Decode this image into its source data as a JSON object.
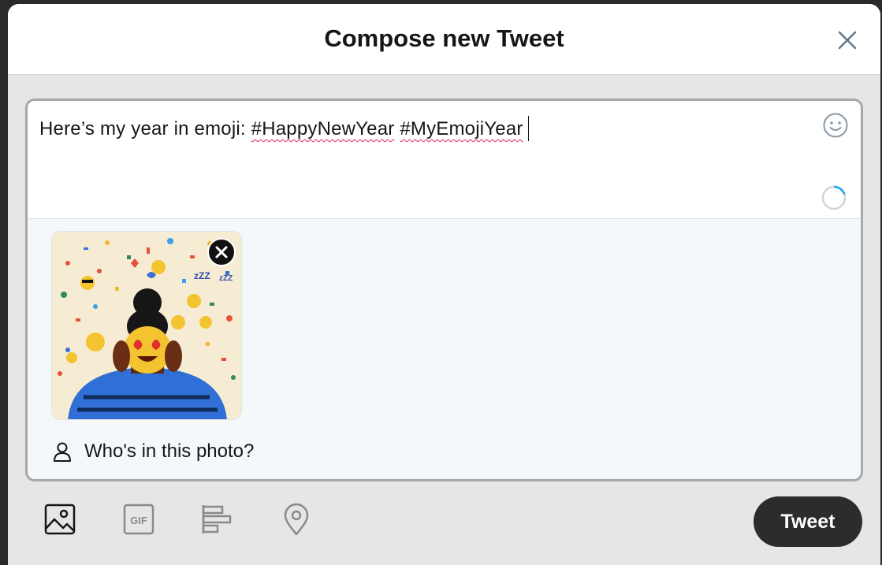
{
  "dialog": {
    "title": "Compose new Tweet",
    "close_icon": "close-icon"
  },
  "composer": {
    "text_prefix": "Here’s my year in emoji: ",
    "hashtags": [
      "#HappyNewYear",
      "#MyEmojiYear"
    ],
    "emoji_icon": "smiley-icon",
    "counter_progress": 0.2
  },
  "media": {
    "remove_icon": "close-icon",
    "tag_people_label": "Who's in this photo?",
    "tag_people_icon": "person-icon"
  },
  "toolbar": {
    "items": [
      "image-icon",
      "gif-icon",
      "poll-icon",
      "location-icon"
    ],
    "tweet_label": "Tweet"
  },
  "colors": {
    "accent": "#1da1f2",
    "tweet_button": "#2c2c2c",
    "icon_gray": "#657786"
  }
}
